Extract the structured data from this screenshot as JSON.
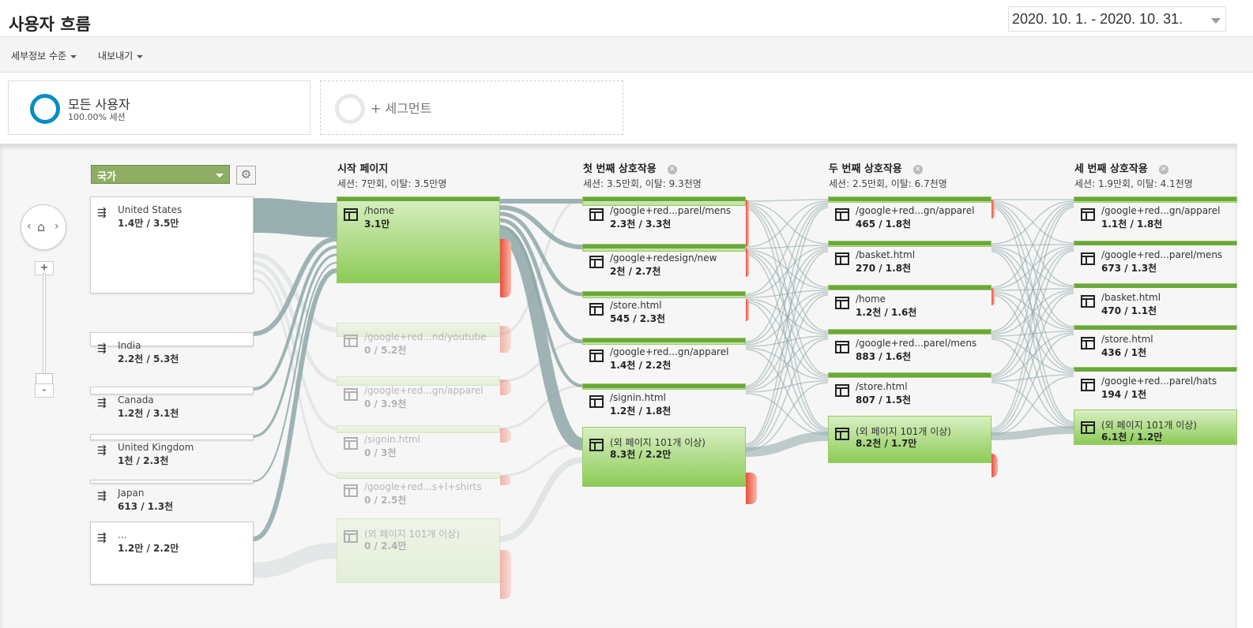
{
  "title": "사용자 흐름",
  "date_range": "2020. 10. 1. - 2020. 10. 31.",
  "toolbar": {
    "detail_level": "세부정보 수준",
    "export": "내보내기"
  },
  "segments": {
    "all_users": {
      "name": "모든 사용자",
      "sub": "100.00% 세션"
    },
    "add": {
      "label": "+ 세그먼트"
    }
  },
  "dimension": {
    "label": "국가"
  },
  "columns": {
    "start": {
      "title": "시작 페이지",
      "stats": "세션: 7만회, 이탈: 3.5만명"
    },
    "first": {
      "title": "첫 번째 상호작용",
      "stats": "세션: 3.5만회, 이탈: 9.3천명"
    },
    "second": {
      "title": "두 번째 상호작용",
      "stats": "세션: 2.5만회, 이탈: 6.7천명"
    },
    "third": {
      "title": "세 번째 상호작용",
      "stats": "세션: 1.9만회, 이탈: 4.1천명"
    }
  },
  "countries": [
    {
      "name": "United States",
      "value": "1.4만 / 3.5만"
    },
    {
      "name": "India",
      "value": "2.2천 / 5.3천"
    },
    {
      "name": "Canada",
      "value": "1.2천 / 3.1천"
    },
    {
      "name": "United Kingdom",
      "value": "1천 / 2.3천"
    },
    {
      "name": "Japan",
      "value": "613 / 1.3천"
    },
    {
      "name": "...",
      "value": "1.2만 / 2.2만"
    }
  ],
  "start_pages": [
    {
      "name": "/home",
      "value": "3.1만"
    },
    {
      "name": "/google+red...nd/youtube",
      "value": "0 / 5.2천"
    },
    {
      "name": "/google+red...gn/apparel",
      "value": "0 / 3.9천"
    },
    {
      "name": "/signin.html",
      "value": "0 / 3천"
    },
    {
      "name": "/google+red...s+l+shirts",
      "value": "0 / 2.5천"
    },
    {
      "name": "(외 페이지 101개 이상)",
      "value": "0 / 2.4만"
    }
  ],
  "first_interaction": [
    {
      "name": "/google+red...parel/mens",
      "value": "2.3천 / 3.3천"
    },
    {
      "name": "/google+redesign/new",
      "value": "2천 / 2.7천"
    },
    {
      "name": "/store.html",
      "value": "545 / 2.3천"
    },
    {
      "name": "/google+red...gn/apparel",
      "value": "1.4천 / 2.2천"
    },
    {
      "name": "/signin.html",
      "value": "1.2천 / 1.8천"
    },
    {
      "name": "(외 페이지 101개 이상)",
      "value": "8.3천 / 2.2만"
    }
  ],
  "second_interaction": [
    {
      "name": "/google+red...gn/apparel",
      "value": "465 / 1.8천"
    },
    {
      "name": "/basket.html",
      "value": "270 / 1.8천"
    },
    {
      "name": "/home",
      "value": "1.2천 / 1.6천"
    },
    {
      "name": "/google+red...parel/mens",
      "value": "883 / 1.6천"
    },
    {
      "name": "/store.html",
      "value": "807 / 1.5천"
    },
    {
      "name": "(외 페이지 101개 이상)",
      "value": "8.2천 / 1.7만"
    }
  ],
  "third_interaction": [
    {
      "name": "/google+red...gn/apparel",
      "value": "1.1천 / 1.8천"
    },
    {
      "name": "/google+red...parel/mens",
      "value": "673 / 1.3천"
    },
    {
      "name": "/basket.html",
      "value": "470 / 1.1천"
    },
    {
      "name": "/store.html",
      "value": "436 / 1천"
    },
    {
      "name": "/google+red...parel/hats",
      "value": "194 / 1천"
    },
    {
      "name": "(외 페이지 101개 이상)",
      "value": "6.1천 / 1.2만"
    }
  ],
  "colors": {
    "node_green": "#8ccb56",
    "link": "#8fa7a8",
    "dropoff": "#e8503a",
    "segment_ring": "#058dc7"
  }
}
